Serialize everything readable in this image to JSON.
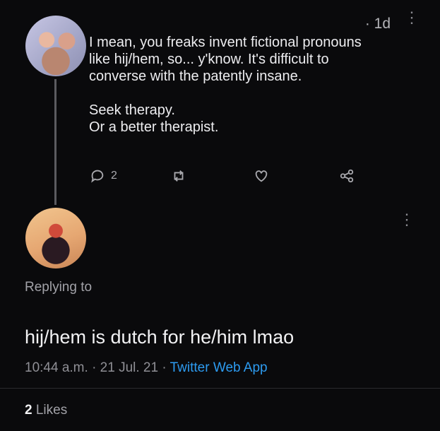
{
  "parent_tweet": {
    "time": "1d",
    "lines_para1": [
      "I mean, you freaks invent fictional pronouns",
      "like hij/hem, so... y'know. It's difficult to",
      "converse with the patently insane."
    ],
    "lines_para2": [
      "Seek therapy.",
      "Or a better therapist."
    ],
    "reply_count": "2"
  },
  "reply_tweet": {
    "replying_label": "Replying to",
    "text": "hij/hem is dutch for he/him lmao",
    "time": "10:44 a.m.",
    "date": "21 Jul. 21",
    "source": "Twitter Web App",
    "likes_count": "2",
    "likes_label": "Likes"
  },
  "icons": [
    "reply-icon",
    "retweet-icon",
    "like-icon",
    "share-icon",
    "more-options-icon"
  ],
  "colors": {
    "background": "#0a0a0c",
    "text": "#ededf0",
    "muted": "#8f8f95",
    "accent": "#2d9bf0"
  }
}
